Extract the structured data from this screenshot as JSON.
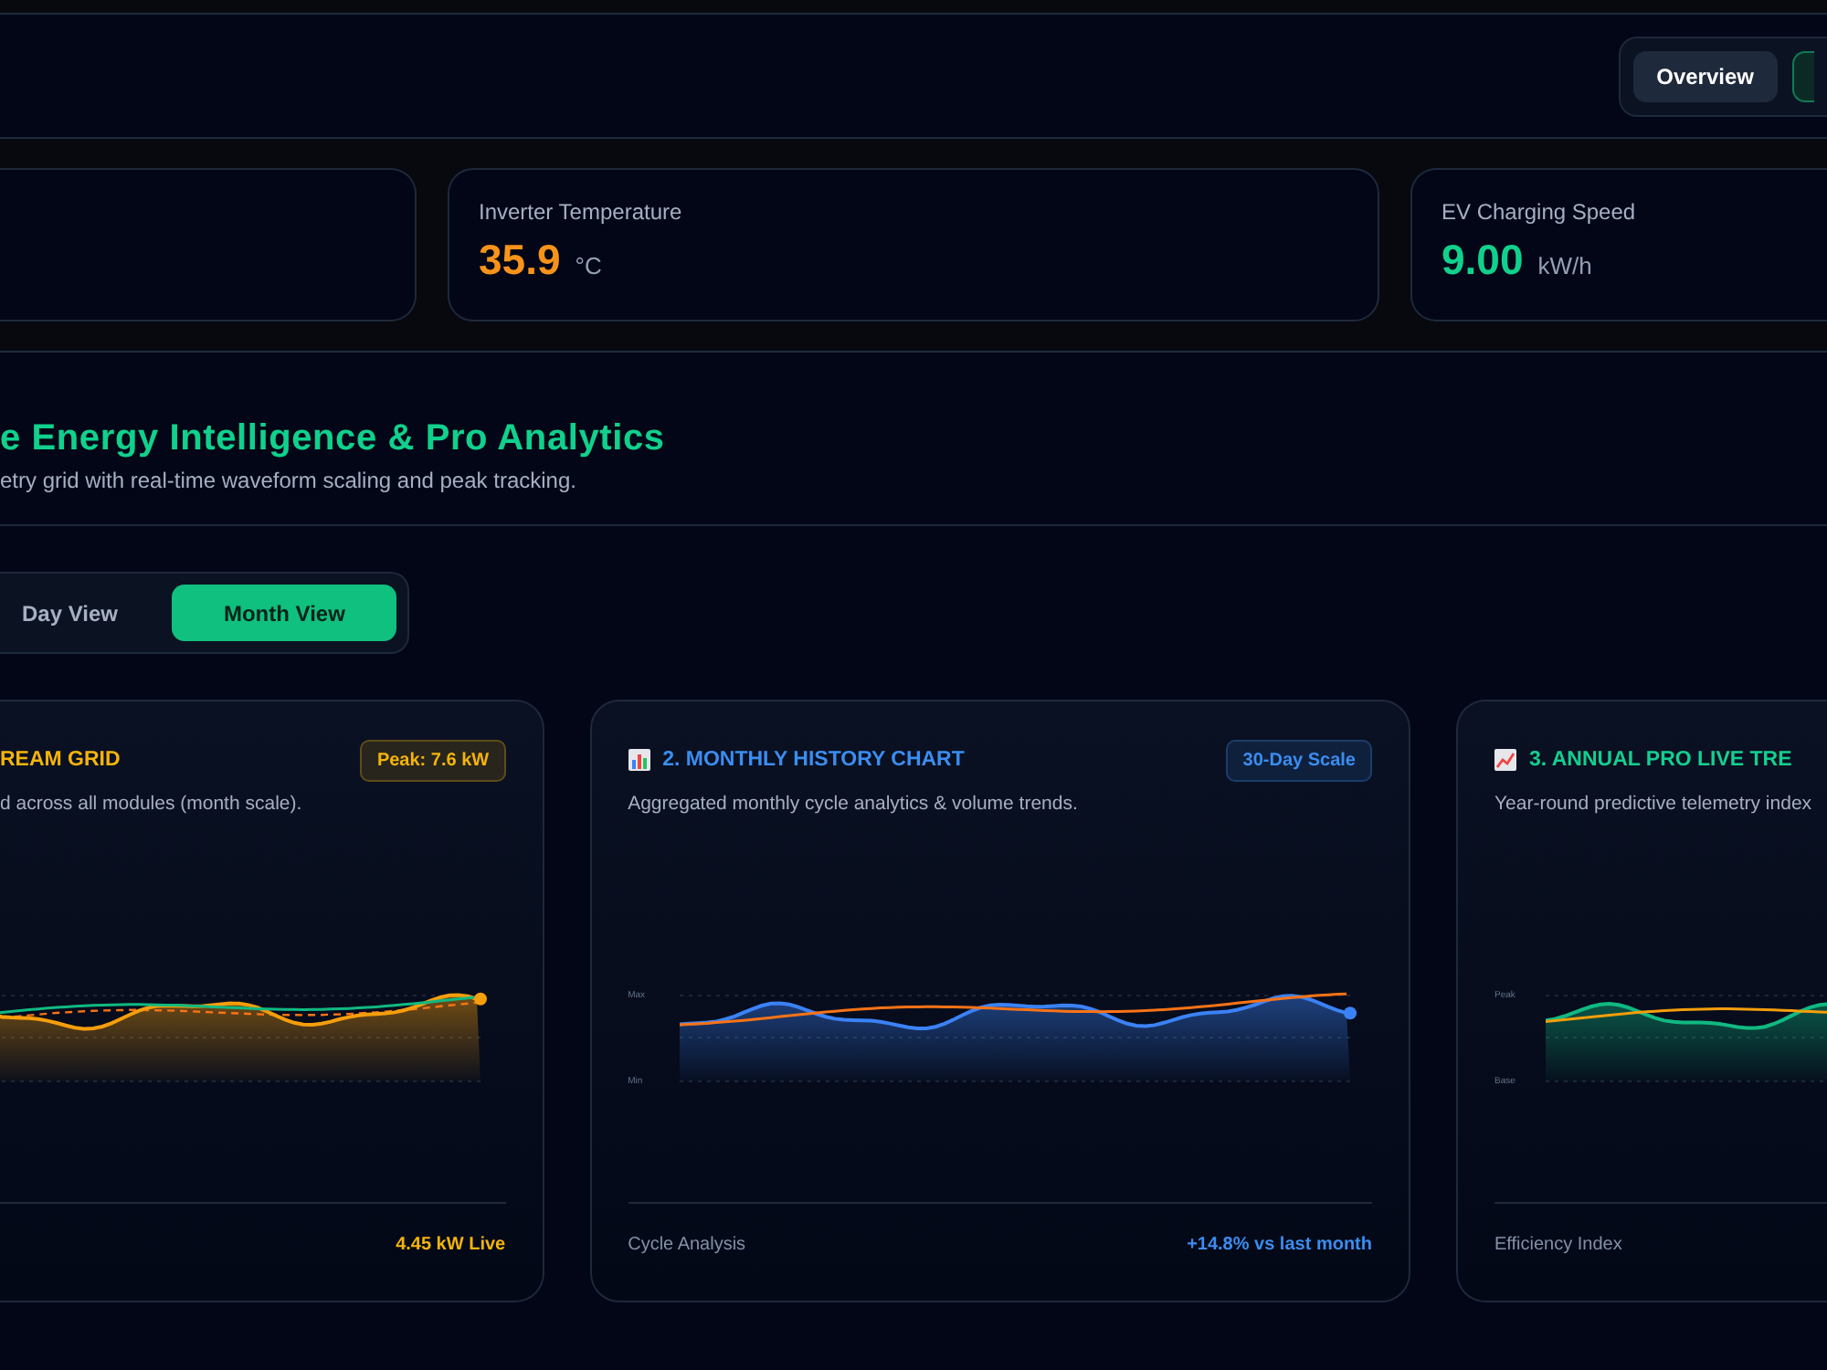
{
  "top_bar": {
    "tabs": [
      {
        "label": "Overview",
        "selected": false
      },
      {
        "selected": true
      }
    ]
  },
  "metrics": [
    {
      "kind": "empty"
    },
    {
      "kind": "metric",
      "label": "Inverter Temperature",
      "value": "35.9",
      "unit": "°C",
      "color": "#f7931a"
    },
    {
      "kind": "metric",
      "label": "EV Charging Speed",
      "value": "9.00",
      "unit": "kW/h",
      "color": "#10d18c"
    }
  ],
  "section": {
    "title": "e Energy Intelligence & Pro Analytics",
    "subtitle": "etry grid with real-time waveform scaling and peak tracking.",
    "view_toggle": [
      {
        "label": "Day View",
        "selected": false
      },
      {
        "label": "Month View",
        "selected": true
      }
    ]
  },
  "chart_cards": [
    {
      "color": "#f5b40b",
      "title": "REAM GRID",
      "badge": "Peak: 7.6 kW",
      "description": "d across all modules (month scale).",
      "footer_right": "4.45 kW Live"
    },
    {
      "color": "#3b8df0",
      "title": "2. MONTHLY HISTORY CHART",
      "badge": "30-Day Scale",
      "description": "Aggregated monthly cycle analytics & volume trends.",
      "axis_labels": [
        "Max",
        "Min"
      ],
      "footer_left": "Cycle Analysis",
      "footer_right": "+14.8% vs last month"
    },
    {
      "color": "#14cf90",
      "title": "3. ANNUAL PRO LIVE TRE",
      "description": "Year-round predictive telemetry index",
      "axis_labels": [
        "Peak",
        "Base"
      ],
      "footer_left": "Efficiency Index"
    }
  ]
}
